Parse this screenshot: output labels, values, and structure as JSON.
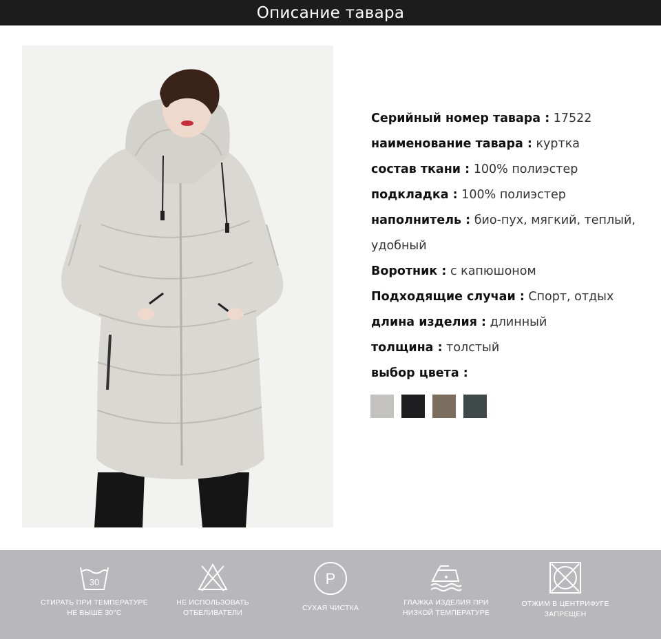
{
  "header": {
    "title": "Описание тавара"
  },
  "specs": [
    {
      "label": "Серийный номер тавара :",
      "value": " 17522"
    },
    {
      "label": "наименование тавара :",
      "value": " куртка"
    },
    {
      "label": "состав ткани :",
      "value": " 100% полиэстер"
    },
    {
      "label": "подкладка :",
      "value": " 100% полиэстер"
    },
    {
      "label": "наполнитель :",
      "value": " био-пух, мягкий, теплый, удобный"
    },
    {
      "label": "Воротник :",
      "value": " с капюшоном"
    },
    {
      "label": "Подходящие случаи :",
      "value": " Спорт, отдых"
    },
    {
      "label": "длина изделия :",
      "value": " длинный"
    },
    {
      "label": "толщина :",
      "value": " толстый"
    },
    {
      "label": "выбор цвета :",
      "value": ""
    }
  ],
  "colors": [
    "#c3c2bf",
    "#1e1e20",
    "#7c6e5e",
    "#3f4a48"
  ],
  "care": [
    {
      "icon": "wash-30-icon",
      "text": "30",
      "label1": "СТИРАТЬ ПРИ ТЕМПЕРАТУРЕ",
      "label2": "НЕ ВЫШЕ 30°С"
    },
    {
      "icon": "no-bleach-icon",
      "label1": "НЕ ИСПОЛЬЗОВАТЬ",
      "label2": "ОТБЕЛИВАТЕЛИ"
    },
    {
      "icon": "dry-clean-icon",
      "text": "P",
      "label1": "СУХАЯ ЧИСТКА",
      "label2": ""
    },
    {
      "icon": "iron-low-icon",
      "label1": "ГЛАЖКА ИЗДЕЛИЯ ПРИ",
      "label2": "НИЗКОЙ ТЕМПЕРАТУРЕ"
    },
    {
      "icon": "no-tumble-dry-icon",
      "label1": "ОТЖИМ В ЦЕНТРИФУГЕ",
      "label2": "ЗАПРЕЩЕН"
    }
  ]
}
